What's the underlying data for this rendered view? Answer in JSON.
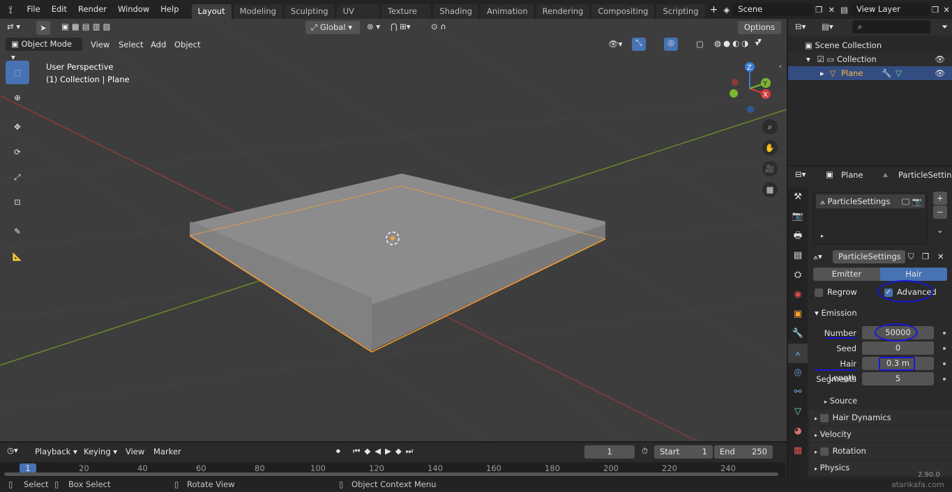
{
  "topbar": {
    "menus": [
      "File",
      "Edit",
      "Render",
      "Window",
      "Help"
    ],
    "workspaces": [
      "Layout",
      "Modeling",
      "Sculpting",
      "UV Editing",
      "Texture Paint",
      "Shading",
      "Animation",
      "Rendering",
      "Compositing",
      "Scripting"
    ],
    "active_workspace": "Layout",
    "scene": "Scene",
    "view_layer": "View Layer"
  },
  "viewport": {
    "orientation": "Global",
    "options": "Options",
    "mode": "Object Mode",
    "menus": [
      "View",
      "Select",
      "Add",
      "Object"
    ],
    "overlay_line1": "User Perspective",
    "overlay_line2": "(1) Collection | Plane",
    "gizmo": {
      "z": "Z",
      "y": "Y",
      "x": "X"
    }
  },
  "outliner": {
    "scene_collection": "Scene Collection",
    "collection": "Collection",
    "object": "Plane"
  },
  "properties": {
    "object": "Plane",
    "particle_settings_tab": "ParticleSettings",
    "list_item": "ParticleSettings",
    "settings_name": "ParticleSettings",
    "type_emitter": "Emitter",
    "type_hair": "Hair",
    "regrow": "Regrow",
    "advanced": "Advanced",
    "emission": "Emission",
    "fields": [
      {
        "label": "Number",
        "value": "50000"
      },
      {
        "label": "Seed",
        "value": "0"
      },
      {
        "label": "Hair Length",
        "value": "0.3 m"
      },
      {
        "label": "Segments",
        "value": "5"
      }
    ],
    "source": "Source",
    "panels": [
      "Hair Dynamics",
      "Velocity",
      "Rotation",
      "Physics"
    ]
  },
  "timeline": {
    "menus": [
      "Playback",
      "Keying",
      "View",
      "Marker"
    ],
    "current_frame": "1",
    "start_label": "Start",
    "start": "1",
    "end_label": "End",
    "end": "250",
    "ticks": [
      "1",
      "20",
      "40",
      "60",
      "80",
      "100",
      "120",
      "140",
      "160",
      "180",
      "200",
      "220",
      "240"
    ]
  },
  "statusbar": {
    "select": "Select",
    "box_select": "Box Select",
    "rotate_view": "Rotate View",
    "context_menu": "Object Context Menu",
    "version": "2.90.0",
    "watermark": "atarikafa.com"
  },
  "colors": {
    "accent": "#4772b3",
    "selection": "#ffa02e",
    "annotation": "#1717d8"
  }
}
